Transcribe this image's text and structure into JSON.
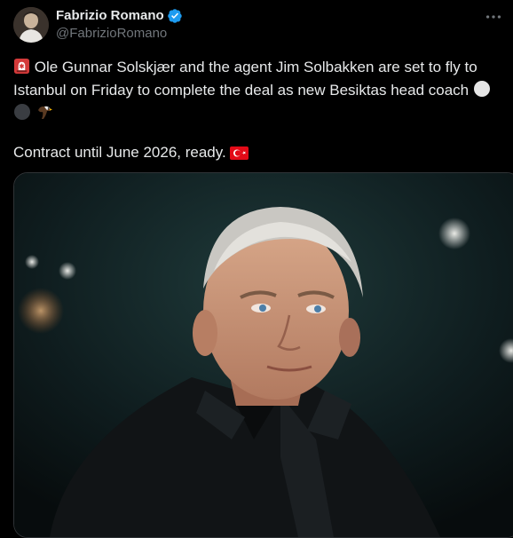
{
  "author": {
    "name": "Fabrizio Romano",
    "handle": "@FabrizioRomano",
    "avatar_icon": "profile-avatar",
    "verified_icon": "verified-badge-icon",
    "verified_color": "#1d9bf0"
  },
  "tweet": {
    "line1": "Ole Gunnar Solskjær and the agent Jim Solbakken are set to fly to",
    "line2": "Istanbul on Friday to complete the deal as new Besiktas head coach",
    "line4": "Contract until June 2026, ready.",
    "emojis": [
      "siren-icon",
      "white-circle-icon",
      "black-circle-icon",
      "eagle-icon",
      "turkey-flag-icon"
    ]
  },
  "colors": {
    "background": "#000000",
    "text": "#e7e9ea",
    "secondary": "#71767b",
    "border": "#2f3336"
  },
  "media": {
    "type": "photo",
    "subject": "man-portrait-stadium"
  }
}
